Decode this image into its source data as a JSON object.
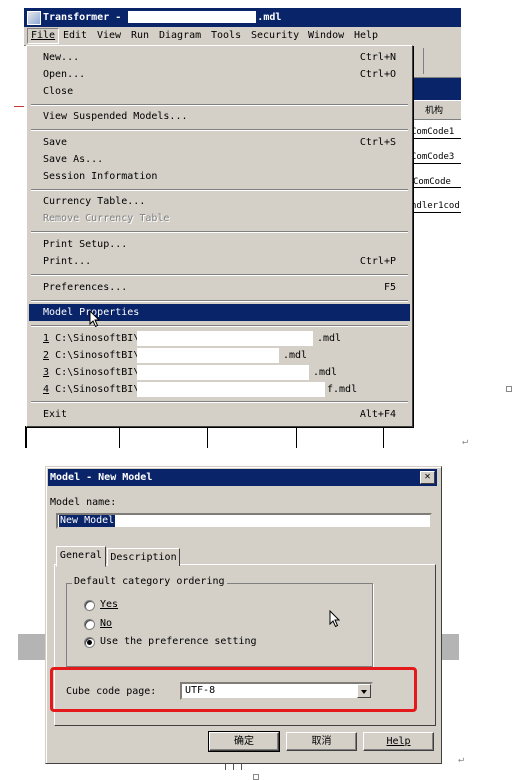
{
  "app": {
    "title_prefix": "Transformer - ",
    "title_suffix": ".mdl"
  },
  "menubar": [
    "File",
    "Edit",
    "View",
    "Run",
    "Diagram",
    "Tools",
    "Security",
    "Window",
    "Help"
  ],
  "file_menu": {
    "new": {
      "label": "New...",
      "shortcut": "Ctrl+N"
    },
    "open": {
      "label": "Open...",
      "shortcut": "Ctrl+O"
    },
    "close": {
      "label": "Close"
    },
    "view_suspended": {
      "label": "View Suspended Models..."
    },
    "save": {
      "label": "Save",
      "shortcut": "Ctrl+S"
    },
    "save_as": {
      "label": "Save As..."
    },
    "session_info": {
      "label": "Session Information"
    },
    "currency_table": {
      "label": "Currency Table..."
    },
    "remove_currency_table": {
      "label": "Remove Currency Table"
    },
    "print_setup": {
      "label": "Print Setup..."
    },
    "print": {
      "label": "Print...",
      "shortcut": "Ctrl+P"
    },
    "preferences": {
      "label": "Preferences...",
      "shortcut": "F5"
    },
    "model_properties": {
      "label": "Model Properties"
    },
    "recent": [
      {
        "num": "1",
        "prefix": "C:\\SinosoftBI\\",
        "suffix": ".mdl"
      },
      {
        "num": "2",
        "prefix": "C:\\SinosoftBI\\",
        "suffix": ".mdl"
      },
      {
        "num": "3",
        "prefix": "C:\\SinosoftBI\\",
        "suffix": ".mdl"
      },
      {
        "num": "4",
        "prefix": "C:\\SinosoftBI\\",
        "suffix": "f.mdl"
      }
    ],
    "exit": {
      "label": "Exit",
      "shortcut": "Alt+F4"
    }
  },
  "right_table": {
    "header": "机构",
    "cells": [
      "ComCode1",
      "ComCode3",
      "ComCode",
      "ndler1cod"
    ]
  },
  "dialog": {
    "title": "Model - New Model",
    "close_symbol": "✕",
    "model_name_label": "Model name:",
    "model_name_value": "New Model",
    "tabs": [
      "General",
      "Description"
    ],
    "group_label": "Default category ordering",
    "options": [
      {
        "label": "Yes",
        "selected": false
      },
      {
        "label": "No",
        "selected": false
      },
      {
        "label": "Use the preference setting",
        "selected": true
      }
    ],
    "cube_code_page_label": "Cube code page:",
    "cube_code_page_value": "UTF-8",
    "buttons": {
      "ok": "确定",
      "cancel": "取消",
      "help": "Help"
    }
  },
  "colors": {
    "highlight": "#0a246a",
    "face": "#d4d0c8",
    "annotation": "#e3191c"
  }
}
